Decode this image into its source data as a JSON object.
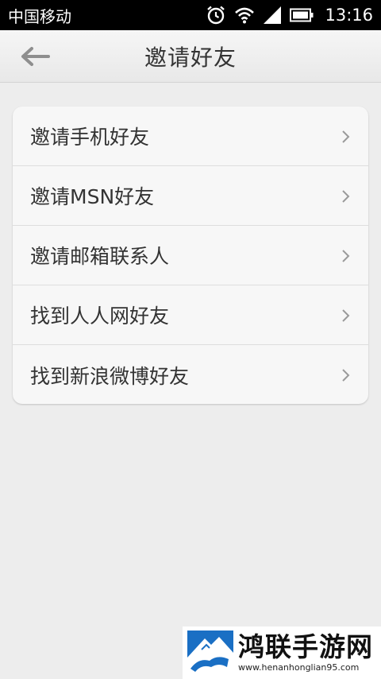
{
  "status_bar": {
    "carrier": "中国移动",
    "time": "13:16",
    "icons": [
      "alarm-icon",
      "wifi-icon",
      "signal-icon",
      "battery-icon"
    ]
  },
  "header": {
    "title": "邀请好友",
    "back_icon": "back-arrow-icon"
  },
  "menu": {
    "items": [
      {
        "label": "邀请手机好友"
      },
      {
        "label": "邀请MSN好友"
      },
      {
        "label": "邀请邮箱联系人"
      },
      {
        "label": "找到人人网好友"
      },
      {
        "label": "找到新浪微博好友"
      }
    ]
  },
  "watermark": {
    "title": "鸿联手游网",
    "url": "www.henanhonglian95.com"
  },
  "colors": {
    "background": "#ededed",
    "card": "#f7f7f7",
    "text": "#333333",
    "chevron": "#9a9a9a",
    "logo_blue": "#1a6fc4"
  }
}
